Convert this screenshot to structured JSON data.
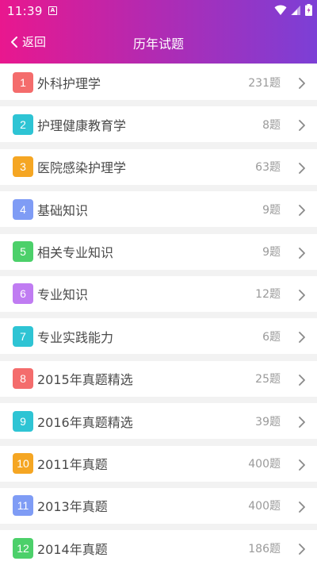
{
  "status": {
    "time": "11:39",
    "notif_icon": "A"
  },
  "nav": {
    "back_label": "返回",
    "title": "历年试题"
  },
  "items": [
    {
      "index": "1",
      "title": "外科护理学",
      "count": "231题",
      "color": "#f46c6c"
    },
    {
      "index": "2",
      "title": "护理健康教育学",
      "count": "8题",
      "color": "#2ec4d4"
    },
    {
      "index": "3",
      "title": "医院感染护理学",
      "count": "63题",
      "color": "#f5a623"
    },
    {
      "index": "4",
      "title": "基础知识",
      "count": "9题",
      "color": "#7f9cf5"
    },
    {
      "index": "5",
      "title": "相关专业知识",
      "count": "9题",
      "color": "#4cd06a"
    },
    {
      "index": "6",
      "title": "专业知识",
      "count": "12题",
      "color": "#c07cf2"
    },
    {
      "index": "7",
      "title": "专业实践能力",
      "count": "6题",
      "color": "#2ec4d4"
    },
    {
      "index": "8",
      "title": "2015年真题精选",
      "count": "25题",
      "color": "#f46c6c"
    },
    {
      "index": "9",
      "title": "2016年真题精选",
      "count": "39题",
      "color": "#2ec4d4"
    },
    {
      "index": "10",
      "title": "2011年真题",
      "count": "400题",
      "color": "#f5a623"
    },
    {
      "index": "11",
      "title": "2013年真题",
      "count": "400题",
      "color": "#7f9cf5"
    },
    {
      "index": "12",
      "title": "2014年真题",
      "count": "186题",
      "color": "#4cd06a"
    }
  ]
}
